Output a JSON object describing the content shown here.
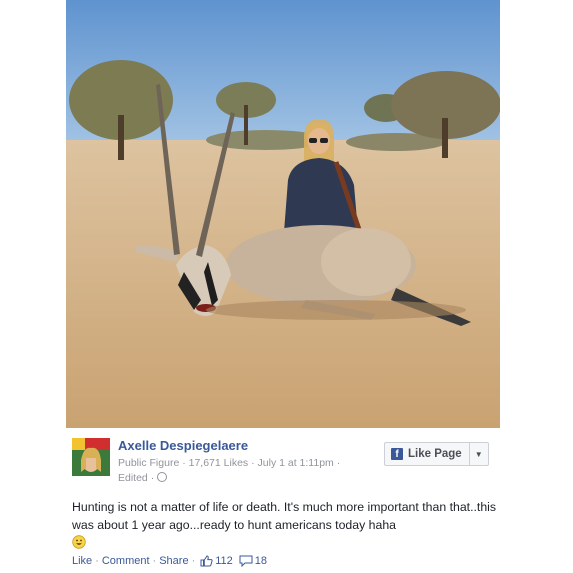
{
  "post": {
    "author": "Axelle Despiegelaere",
    "category": "Public Figure",
    "likes": "17,671 Likes",
    "date": "July 1 at 1:11pm",
    "edited": "Edited",
    "text": "Hunting is not a matter of life or death. It's much more important than that..this was about 1 year ago...ready to hunt americans today haha",
    "emoji": "smile-emoji"
  },
  "like_page_button": {
    "label": "Like Page",
    "icon": "facebook-f-icon",
    "dropdown_icon": "chevron-down-icon"
  },
  "actions": {
    "like": "Like",
    "comment": "Comment",
    "share": "Share",
    "like_count": "112",
    "comment_count": "18"
  },
  "colors": {
    "link": "#3b5998",
    "meta": "#90949c",
    "text": "#1d2129",
    "sky": "#6a9bd0",
    "ground": "#d6b487"
  }
}
